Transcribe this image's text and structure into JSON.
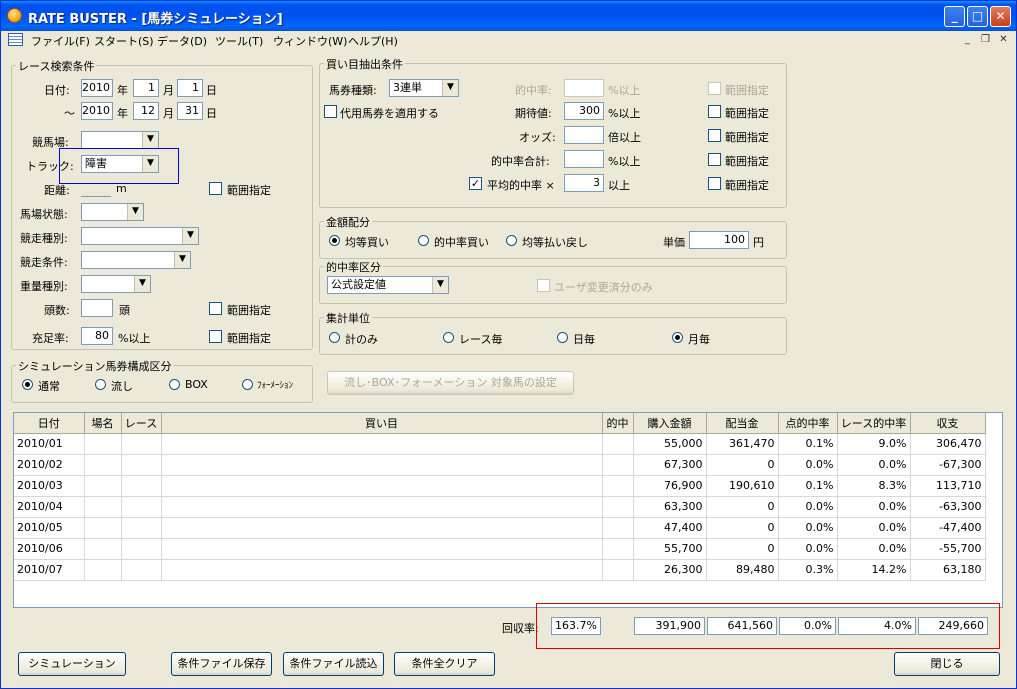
{
  "window": {
    "title": "RATE BUSTER - [馬券シミュレーション]"
  },
  "menu": [
    "ファイル(F)",
    "スタート(S)",
    "データ(D)",
    "ツール(T)",
    "ウィンドウ(W)",
    "ヘルプ(H)"
  ],
  "search": {
    "group_label": "レース検索条件",
    "date_label": "日付:",
    "date_sep": "～",
    "from": {
      "year": "2010",
      "month": "1",
      "day": "1"
    },
    "to": {
      "year": "2010",
      "month": "12",
      "day": "31"
    },
    "year_unit": "年",
    "month_unit": "月",
    "day_unit": "日",
    "racecourse_label": "競馬場:",
    "racecourse_value": "",
    "track_label": "トラック:",
    "track_value": "障害",
    "distance_label": "距離:",
    "distance_unit": "m",
    "range_label": "範囲指定",
    "going_label": "馬場状態:",
    "race_type_label": "競走種別:",
    "race_cond_label": "競走条件:",
    "weight_type_label": "重量種別:",
    "heads_label": "頭数:",
    "heads_unit": "頭",
    "fill_rate_label": "充足率:",
    "fill_rate_value": "80",
    "fill_rate_unit": "%以上"
  },
  "bet": {
    "group_label": "買い目抽出条件",
    "type_label": "馬券種類:",
    "type_value": "3連単",
    "substitute_label": "代用馬券を適用する",
    "hit_rate_label": "的中率:",
    "hit_rate_unit": "%以上",
    "expectation_label": "期待値:",
    "expectation_value": "300",
    "expectation_unit": "%以上",
    "odds_label": "オッズ:",
    "odds_unit": "倍以上",
    "hit_total_label": "的中率合計:",
    "hit_total_unit": "%以上",
    "avg_hit_label": "平均的中率 ×",
    "avg_hit_value": "3",
    "avg_hit_unit": "以上",
    "range_label": "範囲指定"
  },
  "amount": {
    "group_label": "金額配分",
    "options": [
      "均等買い",
      "的中率買い",
      "均等払い戻し"
    ],
    "unit_label": "単価",
    "unit_value": "100",
    "unit_suffix": "円"
  },
  "hit_class": {
    "group_label": "的中率区分",
    "value": "公式設定値",
    "user_only_label": "ユーザ変更済分のみ"
  },
  "aggregate": {
    "group_label": "集計単位",
    "options": [
      "計のみ",
      "レース毎",
      "日毎",
      "月毎"
    ]
  },
  "composition": {
    "group_label": "シミュレーション馬券構成区分",
    "options": [
      "通常",
      "流し",
      "BOX",
      "ﾌｫｰﾒｰｼｮﾝ"
    ],
    "target_button": "流し･BOX･フォーメーション 対象馬の設定"
  },
  "table": {
    "columns": [
      "日付",
      "場名",
      "レース",
      "買い目",
      "的中",
      "購入金額",
      "配当金",
      "点的中率",
      "レース的中率",
      "収支"
    ],
    "rows": [
      [
        "2010/01",
        "",
        "",
        "",
        "",
        "55,000",
        "361,470",
        "0.1%",
        "9.0%",
        "306,470"
      ],
      [
        "2010/02",
        "",
        "",
        "",
        "",
        "67,300",
        "0",
        "0.0%",
        "0.0%",
        "-67,300"
      ],
      [
        "2010/03",
        "",
        "",
        "",
        "",
        "76,900",
        "190,610",
        "0.1%",
        "8.3%",
        "113,710"
      ],
      [
        "2010/04",
        "",
        "",
        "",
        "",
        "63,300",
        "0",
        "0.0%",
        "0.0%",
        "-63,300"
      ],
      [
        "2010/05",
        "",
        "",
        "",
        "",
        "47,400",
        "0",
        "0.0%",
        "0.0%",
        "-47,400"
      ],
      [
        "2010/06",
        "",
        "",
        "",
        "",
        "55,700",
        "0",
        "0.0%",
        "0.0%",
        "-55,700"
      ],
      [
        "2010/07",
        "",
        "",
        "",
        "",
        "26,300",
        "89,480",
        "0.3%",
        "14.2%",
        "63,180"
      ]
    ]
  },
  "summary": {
    "return_label": "回収率:",
    "return_rate": "163.7%",
    "purchase": "391,900",
    "payout": "641,560",
    "point_hit": "0.0%",
    "race_hit": "4.0%",
    "balance": "249,660"
  },
  "buttons": {
    "simulate": "シミュレーション",
    "save": "条件ファイル保存",
    "load": "条件ファイル読込",
    "clear": "条件全クリア",
    "close": "閉じる"
  },
  "colors": {
    "highlight_red": "#e00000",
    "highlight_blue": "#0000e0"
  }
}
